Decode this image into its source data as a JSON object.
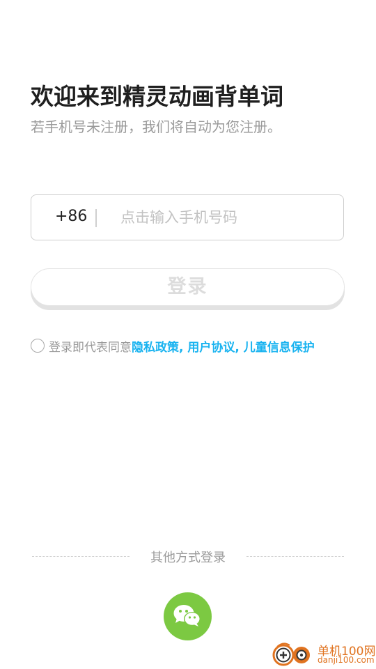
{
  "header": {
    "title": "欢迎来到精灵动画背单词",
    "subtitle": "若手机号未注册，我们将自动为您注册。"
  },
  "phone": {
    "country_code": "+86",
    "placeholder": "点击输入手机号码",
    "value": ""
  },
  "login": {
    "button_label": "登录"
  },
  "agreement": {
    "checked": false,
    "prefix": "登录即代表同意",
    "links": "隐私政策, 用户协议, 儿童信息保护"
  },
  "other_login": {
    "label": "其他方式登录",
    "providers": [
      "wechat"
    ]
  },
  "colors": {
    "link": "#19b3f0",
    "wechat": "#7cc942",
    "watermark": "#e07320"
  },
  "watermark": {
    "text": "单机100网",
    "url_text": "danji100.com"
  }
}
